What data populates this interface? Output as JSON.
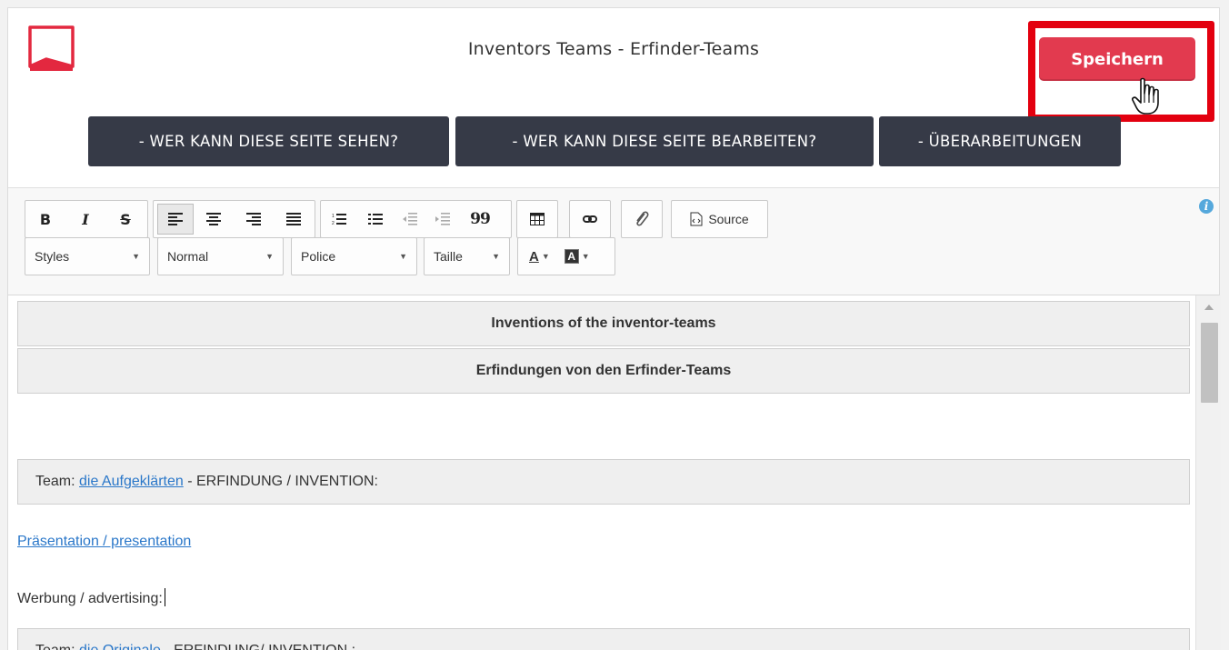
{
  "header": {
    "title": "Inventors Teams - Erfinder-Teams",
    "save_label": "Speichern",
    "brand_color": "#e23a4f",
    "highlight_color": "#e3000f"
  },
  "actions": {
    "see": "- WER KANN DIESE SEITE SEHEN?",
    "edit": "- WER KANN DIESE SEITE BEARBEITEN?",
    "revisions": "- ÜBERARBEITUNGEN"
  },
  "toolbar": {
    "bold": "B",
    "italic": "I",
    "strike": "S",
    "quote": "99",
    "source": "Source",
    "styles": "Styles",
    "format": "Normal",
    "font": "Police",
    "size": "Taille",
    "text_color": "A",
    "bg_color": "A"
  },
  "content": {
    "heading1": "Inventions of the inventor-teams",
    "heading2": "Erfindungen von den Erfinder-Teams",
    "team1": {
      "prefix": "Team: ",
      "name": "die Aufgeklärten",
      "suffix": " - ERFINDUNG / INVENTION:"
    },
    "presentation_link": "Präsentation / presentation",
    "advertising": "Werbung / advertising:",
    "team2": {
      "prefix": "Team: ",
      "name": "die Originale",
      "suffix": " - ERFINDUNG/ INVENTION :"
    }
  }
}
